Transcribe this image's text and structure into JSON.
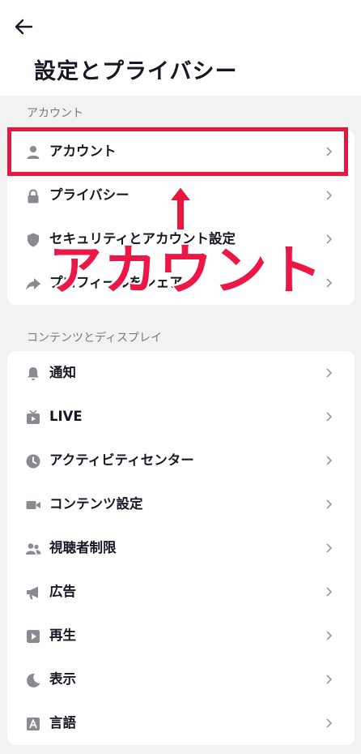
{
  "header": {
    "title": "設定とプライバシー"
  },
  "sections": [
    {
      "label": "アカウント",
      "items": [
        {
          "icon": "person-icon",
          "label": "アカウント"
        },
        {
          "icon": "lock-icon",
          "label": "プライバシー"
        },
        {
          "icon": "shield-icon",
          "label": "セキュリティとアカウント設定"
        },
        {
          "icon": "share-icon",
          "label": "プロフィールをシェア"
        }
      ]
    },
    {
      "label": "コンテンツとディスプレイ",
      "items": [
        {
          "icon": "bell-icon",
          "label": "通知"
        },
        {
          "icon": "live-tv-icon",
          "label": "LIVE"
        },
        {
          "icon": "clock-icon",
          "label": "アクティビティセンター"
        },
        {
          "icon": "video-camera-icon",
          "label": "コンテンツ設定"
        },
        {
          "icon": "people-icon",
          "label": "視聴者制限"
        },
        {
          "icon": "megaphone-icon",
          "label": "広告"
        },
        {
          "icon": "play-icon",
          "label": "再生"
        },
        {
          "icon": "moon-icon",
          "label": "表示"
        },
        {
          "icon": "language-icon",
          "label": "言語"
        }
      ]
    }
  ],
  "annotation": {
    "text": "アカウント",
    "color": "#e8173d"
  },
  "colors": {
    "background": "#f2f2f2",
    "card": "#ffffff",
    "icon": "#8a8b91",
    "highlight": "#e8173d"
  }
}
